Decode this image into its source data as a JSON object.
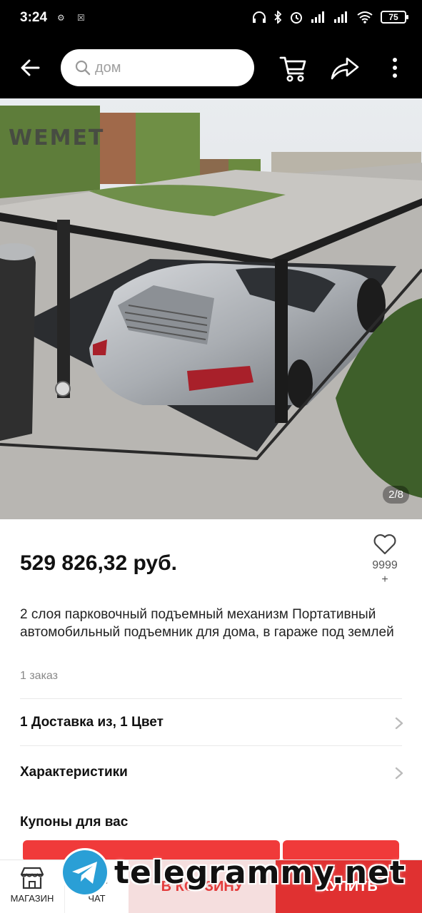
{
  "status_bar": {
    "time": "3:24",
    "battery": "75"
  },
  "search": {
    "placeholder": "дом"
  },
  "gallery": {
    "counter": "2/8",
    "image_logo_text": "WEMET"
  },
  "product": {
    "price": "529 826,32 руб.",
    "wishlist_count": "9999",
    "wishlist_plus": "+",
    "title": "2 слоя парковочный подъемный механизм Портативный автомобильный подъемник для дома, в гараже под землей",
    "orders": "1 заказ"
  },
  "rows": {
    "delivery": "1 Доставка из, 1 Цвет",
    "specs": "Характеристики",
    "coupons": "Купоны для вас"
  },
  "bottom_bar": {
    "store_label": "МАГАЗИН",
    "chat_label": "ЧАТ",
    "add_to_cart": "В КОРЗИНУ",
    "buy_now": "КУПИТЬ"
  },
  "watermark": {
    "text": "telegrammy.net"
  },
  "colors": {
    "accent": "#e03131",
    "accent_light": "#f5dede",
    "header_bg": "#000000"
  },
  "icons": [
    "back-arrow-icon",
    "search-icon",
    "cart-icon",
    "share-icon",
    "more-icon",
    "heart-icon",
    "chevron-right-icon",
    "store-icon",
    "chat-icon",
    "telegram-icon"
  ]
}
